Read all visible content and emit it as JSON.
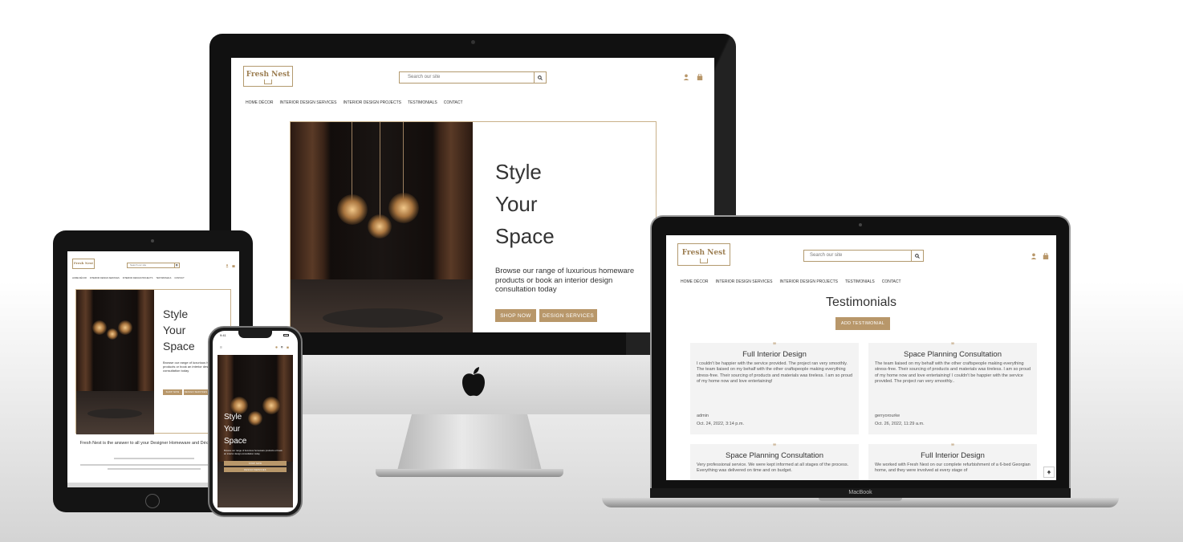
{
  "site": {
    "logo": "Fresh Nest",
    "search_placeholder": "Search our site",
    "nav": [
      "HOME DÉCOR",
      "INTERIOR DESIGN SERVICES",
      "INTERIOR DESIGN PROJECTS",
      "TESTIMONIALS",
      "CONTACT"
    ]
  },
  "hero": {
    "line1": "Style",
    "line2": "Your",
    "line3": "Space",
    "body": "Browse our range of luxurious homeware products or book an interior design consultation today",
    "shop_btn": "SHOP NOW",
    "design_btn": "DESIGN SERVICES"
  },
  "ipad": {
    "tagline": "Fresh Nest is the answer to all your Designer Homeware and Décor needs."
  },
  "iphone": {
    "time": "9:41"
  },
  "testimonials_page": {
    "title": "Testimonials",
    "add_btn": "ADD TESTIMONIAL",
    "cards": [
      {
        "title": "Full Interior Design",
        "body": "I couldn't be happier with the service provided. The project ran very smoothly. The team liaised on my behalf with the other craftspeople making everything stress-free. Their sourcing of products and materials was tireless. I am so proud of my home now and love entertaining!",
        "author": "admin",
        "date": "Oct. 24, 2022, 3:14 p.m."
      },
      {
        "title": "Space Planning Consultation",
        "body": "The team liaised on my behalf with the other craftspeople making everything stress-free. Their sourcing of products and materials was tireless. I am so proud of my home now and love entertaining! I couldn't be happier with the service provided. The project ran very smoothly..",
        "author": "gerryorourke",
        "date": "Oct. 26, 2022, 11:29 a.m."
      },
      {
        "title": "Space Planning Consultation",
        "body": "Very professional service. We were kept informed at all stages of the process. Everything was delivered on time and on budget."
      },
      {
        "title": "Full Interior Design",
        "body": "We worked with Fresh Nest on our complete refurbishment of a 6-bed Georgian home, and they were involved at every stage of"
      }
    ]
  },
  "laptop_name": "MacBook",
  "icons": {
    "search": "search-icon",
    "user": "user-icon",
    "bag": "shopping-bag-icon",
    "apple": "apple-logo-icon",
    "back_to_top": "arrow-up-icon"
  },
  "colors": {
    "accent": "#b8976a",
    "border": "#b39a6f"
  }
}
